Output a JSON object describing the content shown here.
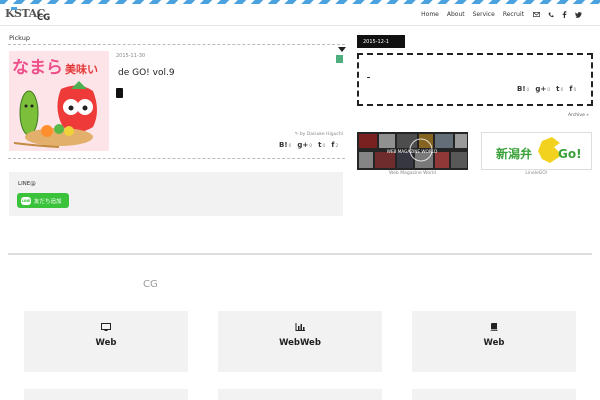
{
  "header": {
    "logo": "KSTAC",
    "tagline": "",
    "site_title": "CG",
    "nav": [
      {
        "label": "Home"
      },
      {
        "label": "About"
      },
      {
        "label": "Service"
      },
      {
        "label": "Recruit"
      }
    ],
    "nav_icons": [
      "mail-icon",
      "phone-icon",
      "facebook-icon",
      "twitter-icon"
    ]
  },
  "pickup": {
    "section_label": "Pickup",
    "thumb_text_pink": "なまら",
    "thumb_text_red": "美味い",
    "date": "2015-11-30",
    "title": "de GO!  vol.9",
    "author": "by Daisuke Higuchi",
    "shares": [
      {
        "icon": "B!",
        "count": "0"
      },
      {
        "icon": "g+",
        "count": "0"
      },
      {
        "icon": "t",
        "count": "0"
      },
      {
        "icon": "f",
        "count": "2"
      }
    ]
  },
  "line": {
    "label": "LINE@",
    "button_logo": "LINE",
    "button_label": "友だち追加"
  },
  "sidebar": {
    "date_tab": "2015-12-1",
    "shares": [
      {
        "icon": "B!",
        "count": "0"
      },
      {
        "icon": "g+",
        "count": "0"
      },
      {
        "icon": "t",
        "count": "0"
      },
      {
        "icon": "f",
        "count": "0"
      }
    ],
    "archive": "Archive »",
    "banners": [
      {
        "caption": "Web Magazine World",
        "overlay": "WEB MAGAZINE WORLD"
      },
      {
        "caption": "LineleGO!",
        "text": "新潟弁",
        "go": "Go!"
      }
    ]
  },
  "services": {
    "heading": "CG",
    "cards": [
      {
        "icon": "monitor-icon",
        "label": "Web"
      },
      {
        "icon": "chart-icon",
        "label": "WebWeb"
      },
      {
        "icon": "book-icon",
        "label": "Web"
      }
    ]
  }
}
